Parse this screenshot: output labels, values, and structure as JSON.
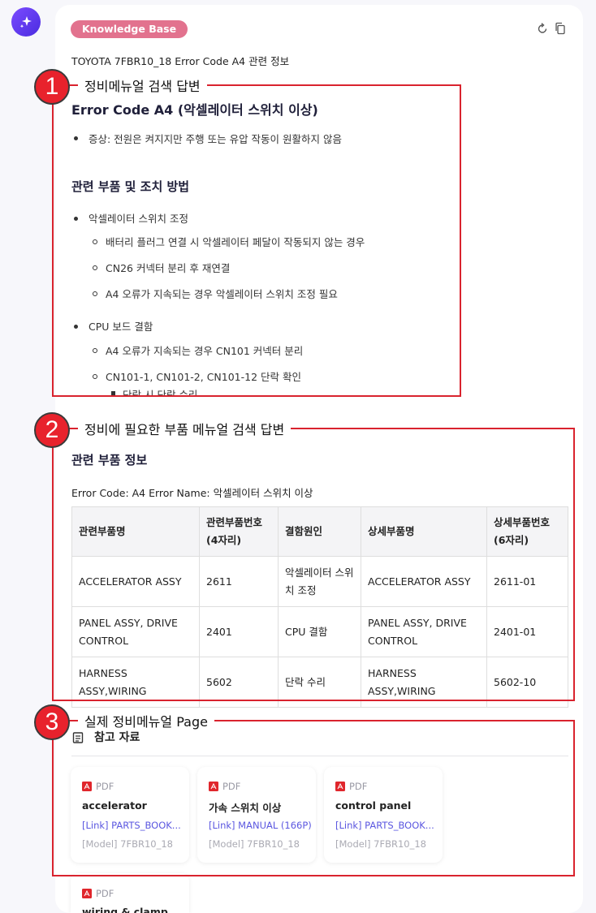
{
  "header": {
    "badge": "Knowledge Base",
    "intro": "TOYOTA 7FBR10_18 Error Code A4 관련 정보"
  },
  "callouts": [
    {
      "num": "1",
      "label": "정비메뉴얼 검색 답변"
    },
    {
      "num": "2",
      "label": "정비에 필요한 부품 메뉴얼 검색 답변"
    },
    {
      "num": "3",
      "label": "실제 정비메뉴얼 Page"
    }
  ],
  "answer": {
    "title": "Error Code A4 (악셀레이터 스위치 이상)",
    "symptom": "증상: 전원은 켜지지만 주행 또는 유압 작동이 원활하지 않음",
    "section_title": "관련 부품 및 조치 방법",
    "item1": "악셀레이터 스위치 조정",
    "item1_sub": [
      "배터리 플러그 연결 시 악셀레이터 페달이 작동되지 않는 경우",
      "CN26 커넥터 분리 후 재연결",
      "A4 오류가 지속되는 경우 악셀레이터 스위치 조정 필요"
    ],
    "item2": "CPU 보드 결함",
    "item2_sub": [
      "A4 오류가 지속되는 경우 CN101 커넥터 분리",
      "CN101-1, CN101-2, CN101-12 단락 확인"
    ],
    "item2_subsub": "단락 시 단락 수리"
  },
  "parts": {
    "title": "관련 부품 정보",
    "error_line": "Error Code: A4 Error Name: 악셀레이터 스위치 이상",
    "headers": [
      "관련부품명",
      "관련부품번호(4자리)",
      "결함원인",
      "상세부품명",
      "상세부품번호(6자리)"
    ],
    "rows": [
      [
        "ACCELERATOR ASSY",
        "2611",
        "악셀레이터 스위치 조정",
        "ACCELERATOR ASSY",
        "2611-01"
      ],
      [
        "PANEL ASSY, DRIVE CONTROL",
        "2401",
        "CPU 결함",
        "PANEL ASSY, DRIVE CONTROL",
        "2401-01"
      ],
      [
        "HARNESS ASSY,WIRING",
        "5602",
        "단락 수리",
        "HARNESS ASSY,WIRING",
        "5602-10"
      ]
    ]
  },
  "references": {
    "title": "참고 자료",
    "cards": [
      {
        "type": "PDF",
        "name": "accelerator",
        "link": "[Link] PARTS_BOOK...",
        "model": "[Model] 7FBR10_18"
      },
      {
        "type": "PDF",
        "name": "가속 스위치 이상",
        "link": "[Link] MANUAL (166P)",
        "model": "[Model] 7FBR10_18"
      },
      {
        "type": "PDF",
        "name": "control panel",
        "link": "[Link] PARTS_BOOK...",
        "model": "[Model] 7FBR10_18"
      },
      {
        "type": "PDF",
        "name": "wiring & clamp",
        "link": "",
        "model": ""
      }
    ]
  },
  "colors": {
    "badge": "#e2728e",
    "callout_red": "#d9232e",
    "link": "#5b57e0",
    "avatar": "#5a36f0"
  },
  "icons": [
    "sparkle-icon",
    "refresh-icon",
    "copy-icon",
    "document-icon",
    "pdf-icon"
  ]
}
